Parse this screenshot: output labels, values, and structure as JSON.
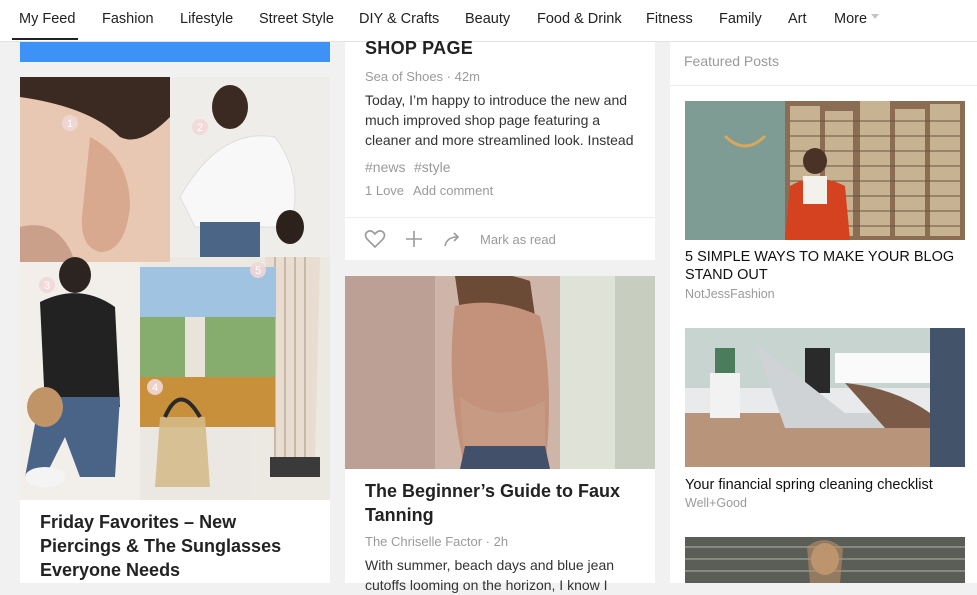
{
  "nav": {
    "items": [
      {
        "label": "My Feed",
        "active": true
      },
      {
        "label": "Fashion"
      },
      {
        "label": "Lifestyle"
      },
      {
        "label": "Street Style"
      },
      {
        "label": "DIY & Crafts"
      },
      {
        "label": "Beauty"
      },
      {
        "label": "Food & Drink"
      },
      {
        "label": "Fitness"
      },
      {
        "label": "Family"
      },
      {
        "label": "Art"
      },
      {
        "label": "More"
      }
    ]
  },
  "column1": {
    "post_title": "Friday Favorites – New Piercings & The Sunglasses Everyone Needs",
    "collage_numbers": [
      "1",
      "2",
      "3",
      "4",
      "5"
    ]
  },
  "column2": {
    "post1": {
      "title": "SHOP PAGE",
      "source": "Sea of Shoes",
      "time": "42m",
      "body": "Today, I’m happy to introduce the new and much improved shop page featuring a cleaner and more streamlined look. Instead",
      "tags": [
        "#news",
        "#style"
      ],
      "love": "1 Love",
      "comment": "Add comment",
      "mark_read": "Mark as read"
    },
    "post2": {
      "title": "The Beginner’s Guide to Faux Tanning",
      "source": "The Chriselle Factor",
      "time": "2h",
      "body": "With summer, beach days and blue jean cutoffs looming on the horizon, I know I"
    }
  },
  "featured": {
    "heading": "Featured Posts",
    "items": [
      {
        "title": "5 SIMPLE WAYS TO MAKE YOUR BLOG STAND OUT",
        "source": "NotJessFashion"
      },
      {
        "title": "Your financial spring cleaning checklist",
        "source": "Well+Good"
      }
    ]
  },
  "colors": {
    "accent_blue": "#3d93f5",
    "text": "#222222",
    "muted": "#9a9a9a"
  }
}
